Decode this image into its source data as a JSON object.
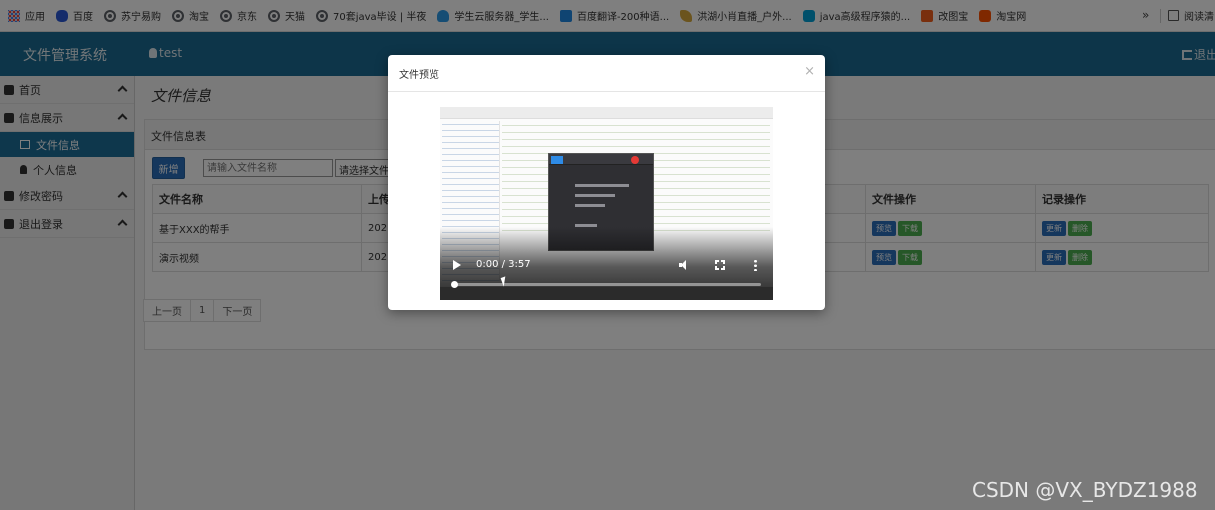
{
  "bookmarks": {
    "items": [
      {
        "label": "应用",
        "icon": "apps-grid-icon"
      },
      {
        "label": "百度",
        "icon": "baidu-paw-icon"
      },
      {
        "label": "苏宁易购",
        "icon": "globe-icon"
      },
      {
        "label": "淘宝",
        "icon": "globe-icon"
      },
      {
        "label": "京东",
        "icon": "globe-icon"
      },
      {
        "label": "天猫",
        "icon": "globe-icon"
      },
      {
        "label": "70套java毕设 | 半夜",
        "icon": "globe-icon"
      },
      {
        "label": "学生云服务器_学生...",
        "icon": "cloud-icon"
      },
      {
        "label": "百度翻译-200种语...",
        "icon": "translate-icon"
      },
      {
        "label": "洪湖小肖直播_户外...",
        "icon": "feather-icon"
      },
      {
        "label": "java高级程序猿的...",
        "icon": "bilibili-icon"
      },
      {
        "label": "改图宝",
        "icon": "orange-square-icon"
      },
      {
        "label": "淘宝网",
        "icon": "taobao-icon"
      }
    ],
    "more": "»",
    "reading_list": "阅读清"
  },
  "header": {
    "brand": "文件管理系统",
    "user": "test",
    "logout": "退出"
  },
  "sidebar": {
    "items": [
      {
        "label": "首页"
      },
      {
        "label": "信息展示",
        "children": [
          {
            "label": "文件信息",
            "active": true
          },
          {
            "label": "个人信息"
          }
        ]
      },
      {
        "label": "修改密码"
      },
      {
        "label": "退出登录"
      }
    ]
  },
  "main": {
    "title": "文件信息",
    "panel_title": "文件信息表",
    "new_button": "新增",
    "search_placeholder": "请输入文件名称",
    "select_value": "请选择文件",
    "columns": [
      "文件名称",
      "上传",
      "文件操作",
      "记录操作"
    ],
    "rows": [
      {
        "name": "基于XXX的帮手",
        "upload": "202"
      },
      {
        "name": "演示视频",
        "upload": "202"
      }
    ],
    "actions": {
      "preview": "预览",
      "download": "下载",
      "update": "更新",
      "delete": "删除"
    },
    "pager": {
      "prev": "上一页",
      "page": "1",
      "next": "下一页"
    }
  },
  "modal": {
    "title": "文件预览",
    "close": "×",
    "video": {
      "time": "0:00 / 3:57",
      "progress": 0.0
    }
  },
  "watermark": "CSDN @VX_BYDZ1988",
  "colors": {
    "header": "#1b6b92",
    "active_nav": "#1d6e98",
    "primary": "#2a6ebb",
    "success": "#4caf50"
  }
}
